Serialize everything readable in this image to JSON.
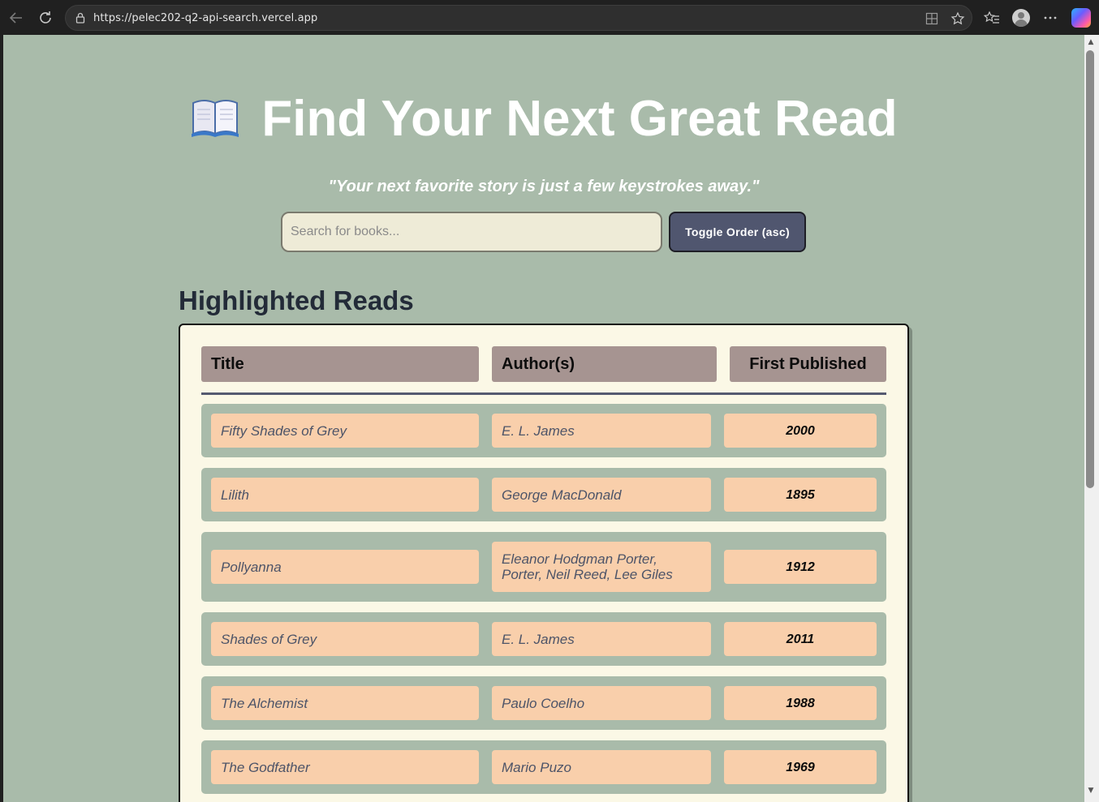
{
  "browser": {
    "url": "https://pelec202-q2-api-search.vercel.app"
  },
  "page": {
    "title": "Find Your Next Great Read",
    "tagline": "\"Your next favorite story is just a few keystrokes away.\"",
    "search": {
      "placeholder": "Search for books...",
      "value": ""
    },
    "toggle_label": "Toggle Order (asc)",
    "section_heading": "Highlighted Reads",
    "table": {
      "headers": {
        "title": "Title",
        "author": "Author(s)",
        "published": "First Published"
      },
      "rows": [
        {
          "title": "Fifty Shades of Grey",
          "author": "E. L. James",
          "year": "2000"
        },
        {
          "title": "Lilith",
          "author": "George MacDonald",
          "year": "1895"
        },
        {
          "title": "Pollyanna",
          "author": "Eleanor Hodgman Porter, Porter, Neil Reed, Lee Giles",
          "year": "1912"
        },
        {
          "title": "Shades of Grey",
          "author": "E. L. James",
          "year": "2011"
        },
        {
          "title": "The Alchemist",
          "author": "Paulo Coelho",
          "year": "1988"
        },
        {
          "title": "The Godfather",
          "author": "Mario Puzo",
          "year": "1969"
        }
      ]
    }
  },
  "colors": {
    "page_bg": "#a9bbaa",
    "card_bg": "#fbf8e6",
    "header_cell": "#a69491",
    "data_cell": "#f9cfab",
    "button": "#50566f"
  }
}
